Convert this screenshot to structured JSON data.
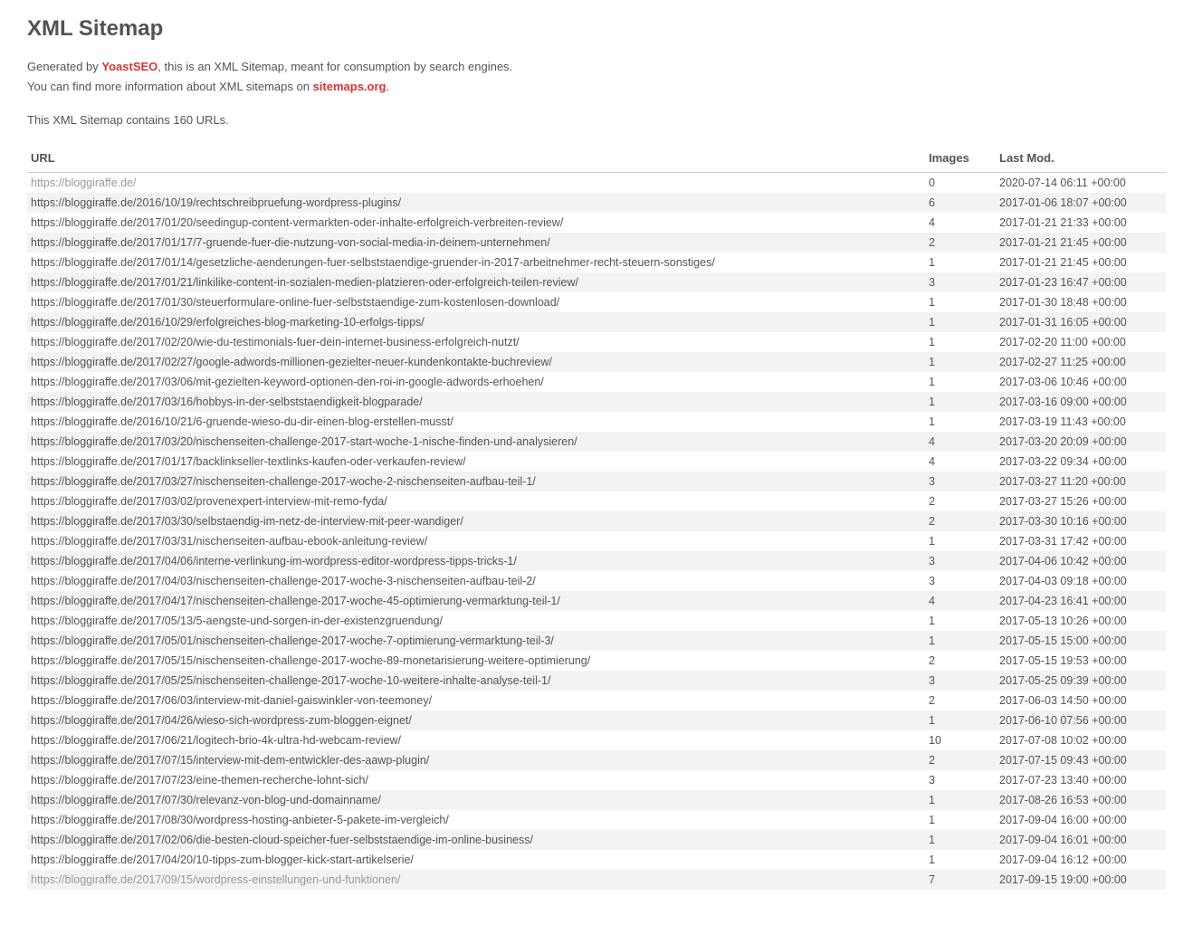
{
  "title": "XML Sitemap",
  "intro": {
    "line1_pre": "Generated by ",
    "line1_link": "YoastSEO",
    "line1_post": ", this is an XML Sitemap, meant for consumption by search engines.",
    "line2_pre": "You can find more information about XML sitemaps on ",
    "line2_link": "sitemaps.org",
    "line2_post": "."
  },
  "count_text": "This XML Sitemap contains 160 URLs.",
  "headers": {
    "url": "URL",
    "images": "Images",
    "lastmod": "Last Mod."
  },
  "rows": [
    {
      "url": "https://bloggiraffe.de/",
      "images": "0",
      "lastmod": "2020-07-14 06:11 +00:00"
    },
    {
      "url": "https://bloggiraffe.de/2016/10/19/rechtschreibpruefung-wordpress-plugins/",
      "images": "6",
      "lastmod": "2017-01-06 18:07 +00:00"
    },
    {
      "url": "https://bloggiraffe.de/2017/01/20/seedingup-content-vermarkten-oder-inhalte-erfolgreich-verbreiten-review/",
      "images": "4",
      "lastmod": "2017-01-21 21:33 +00:00"
    },
    {
      "url": "https://bloggiraffe.de/2017/01/17/7-gruende-fuer-die-nutzung-von-social-media-in-deinem-unternehmen/",
      "images": "2",
      "lastmod": "2017-01-21 21:45 +00:00"
    },
    {
      "url": "https://bloggiraffe.de/2017/01/14/gesetzliche-aenderungen-fuer-selbststaendige-gruender-in-2017-arbeitnehmer-recht-steuern-sonstiges/",
      "images": "1",
      "lastmod": "2017-01-21 21:45 +00:00"
    },
    {
      "url": "https://bloggiraffe.de/2017/01/21/linkilike-content-in-sozialen-medien-platzieren-oder-erfolgreich-teilen-review/",
      "images": "3",
      "lastmod": "2017-01-23 16:47 +00:00"
    },
    {
      "url": "https://bloggiraffe.de/2017/01/30/steuerformulare-online-fuer-selbststaendige-zum-kostenlosen-download/",
      "images": "1",
      "lastmod": "2017-01-30 18:48 +00:00"
    },
    {
      "url": "https://bloggiraffe.de/2016/10/29/erfolgreiches-blog-marketing-10-erfolgs-tipps/",
      "images": "1",
      "lastmod": "2017-01-31 16:05 +00:00"
    },
    {
      "url": "https://bloggiraffe.de/2017/02/20/wie-du-testimonials-fuer-dein-internet-business-erfolgreich-nutzt/",
      "images": "1",
      "lastmod": "2017-02-20 11:00 +00:00"
    },
    {
      "url": "https://bloggiraffe.de/2017/02/27/google-adwords-millionen-gezielter-neuer-kundenkontakte-buchreview/",
      "images": "1",
      "lastmod": "2017-02-27 11:25 +00:00"
    },
    {
      "url": "https://bloggiraffe.de/2017/03/06/mit-gezielten-keyword-optionen-den-roi-in-google-adwords-erhoehen/",
      "images": "1",
      "lastmod": "2017-03-06 10:46 +00:00"
    },
    {
      "url": "https://bloggiraffe.de/2017/03/16/hobbys-in-der-selbststaendigkeit-blogparade/",
      "images": "1",
      "lastmod": "2017-03-16 09:00 +00:00"
    },
    {
      "url": "https://bloggiraffe.de/2016/10/21/6-gruende-wieso-du-dir-einen-blog-erstellen-musst/",
      "images": "1",
      "lastmod": "2017-03-19 11:43 +00:00"
    },
    {
      "url": "https://bloggiraffe.de/2017/03/20/nischenseiten-challenge-2017-start-woche-1-nische-finden-und-analysieren/",
      "images": "4",
      "lastmod": "2017-03-20 20:09 +00:00"
    },
    {
      "url": "https://bloggiraffe.de/2017/01/17/backlinkseller-textlinks-kaufen-oder-verkaufen-review/",
      "images": "4",
      "lastmod": "2017-03-22 09:34 +00:00"
    },
    {
      "url": "https://bloggiraffe.de/2017/03/27/nischenseiten-challenge-2017-woche-2-nischenseiten-aufbau-teil-1/",
      "images": "3",
      "lastmod": "2017-03-27 11:20 +00:00"
    },
    {
      "url": "https://bloggiraffe.de/2017/03/02/provenexpert-interview-mit-remo-fyda/",
      "images": "2",
      "lastmod": "2017-03-27 15:26 +00:00"
    },
    {
      "url": "https://bloggiraffe.de/2017/03/30/selbstaendig-im-netz-de-interview-mit-peer-wandiger/",
      "images": "2",
      "lastmod": "2017-03-30 10:16 +00:00"
    },
    {
      "url": "https://bloggiraffe.de/2017/03/31/nischenseiten-aufbau-ebook-anleitung-review/",
      "images": "1",
      "lastmod": "2017-03-31 17:42 +00:00"
    },
    {
      "url": "https://bloggiraffe.de/2017/04/06/interne-verlinkung-im-wordpress-editor-wordpress-tipps-tricks-1/",
      "images": "3",
      "lastmod": "2017-04-06 10:42 +00:00"
    },
    {
      "url": "https://bloggiraffe.de/2017/04/03/nischenseiten-challenge-2017-woche-3-nischenseiten-aufbau-teil-2/",
      "images": "3",
      "lastmod": "2017-04-03 09:18 +00:00"
    },
    {
      "url": "https://bloggiraffe.de/2017/04/17/nischenseiten-challenge-2017-woche-45-optimierung-vermarktung-teil-1/",
      "images": "4",
      "lastmod": "2017-04-23 16:41 +00:00"
    },
    {
      "url": "https://bloggiraffe.de/2017/05/13/5-aengste-und-sorgen-in-der-existenzgruendung/",
      "images": "1",
      "lastmod": "2017-05-13 10:26 +00:00"
    },
    {
      "url": "https://bloggiraffe.de/2017/05/01/nischenseiten-challenge-2017-woche-7-optimierung-vermarktung-teil-3/",
      "images": "1",
      "lastmod": "2017-05-15 15:00 +00:00"
    },
    {
      "url": "https://bloggiraffe.de/2017/05/15/nischenseiten-challenge-2017-woche-89-monetarisierung-weitere-optimierung/",
      "images": "2",
      "lastmod": "2017-05-15 19:53 +00:00"
    },
    {
      "url": "https://bloggiraffe.de/2017/05/25/nischenseiten-challenge-2017-woche-10-weitere-inhalte-analyse-teil-1/",
      "images": "3",
      "lastmod": "2017-05-25 09:39 +00:00"
    },
    {
      "url": "https://bloggiraffe.de/2017/06/03/interview-mit-daniel-gaiswinkler-von-teemoney/",
      "images": "2",
      "lastmod": "2017-06-03 14:50 +00:00"
    },
    {
      "url": "https://bloggiraffe.de/2017/04/26/wieso-sich-wordpress-zum-bloggen-eignet/",
      "images": "1",
      "lastmod": "2017-06-10 07:56 +00:00"
    },
    {
      "url": "https://bloggiraffe.de/2017/06/21/logitech-brio-4k-ultra-hd-webcam-review/",
      "images": "10",
      "lastmod": "2017-07-08 10:02 +00:00"
    },
    {
      "url": "https://bloggiraffe.de/2017/07/15/interview-mit-dem-entwickler-des-aawp-plugin/",
      "images": "2",
      "lastmod": "2017-07-15 09:43 +00:00"
    },
    {
      "url": "https://bloggiraffe.de/2017/07/23/eine-themen-recherche-lohnt-sich/",
      "images": "3",
      "lastmod": "2017-07-23 13:40 +00:00"
    },
    {
      "url": "https://bloggiraffe.de/2017/07/30/relevanz-von-blog-und-domainname/",
      "images": "1",
      "lastmod": "2017-08-26 16:53 +00:00"
    },
    {
      "url": "https://bloggiraffe.de/2017/08/30/wordpress-hosting-anbieter-5-pakete-im-vergleich/",
      "images": "1",
      "lastmod": "2017-09-04 16:00 +00:00"
    },
    {
      "url": "https://bloggiraffe.de/2017/02/06/die-besten-cloud-speicher-fuer-selbststaendige-im-online-business/",
      "images": "1",
      "lastmod": "2017-09-04 16:01 +00:00"
    },
    {
      "url": "https://bloggiraffe.de/2017/04/20/10-tipps-zum-blogger-kick-start-artikelserie/",
      "images": "1",
      "lastmod": "2017-09-04 16:12 +00:00"
    },
    {
      "url": "https://bloggiraffe.de/2017/09/15/wordpress-einstellungen-und-funktionen/",
      "images": "7",
      "lastmod": "2017-09-15 19:00 +00:00"
    }
  ]
}
